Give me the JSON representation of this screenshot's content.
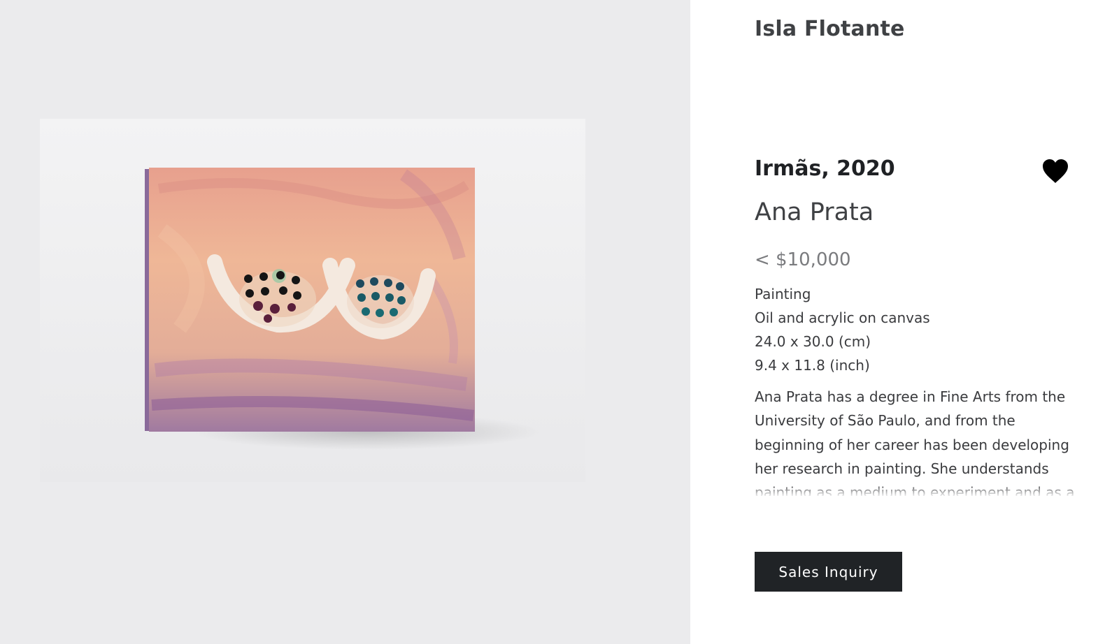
{
  "header": {
    "gallery_name": "Isla Flotante"
  },
  "artwork": {
    "image_alt": "Irmãs, 2020 by Ana Prata",
    "title": "Irmãs, 2020",
    "artist": "Ana Prata",
    "price": "< $10,000",
    "medium_category": "Painting",
    "materials": "Oil and acrylic on canvas",
    "dimensions_cm": "24.0 x 30.0 (cm)",
    "dimensions_in": "9.4 x 11.8 (inch)",
    "bio": "Ana Prata has a degree in Fine Arts from the University of São Paulo, and from the beginning of her career has been developing her research in painting. She understands painting as a medium to experiment and as a language."
  },
  "actions": {
    "favorite_icon": "heart-icon",
    "sales_inquiry_label": "Sales Inquiry"
  },
  "colors": {
    "left_background": "#ebebed",
    "button_background": "#202326",
    "heart": "#000000"
  }
}
